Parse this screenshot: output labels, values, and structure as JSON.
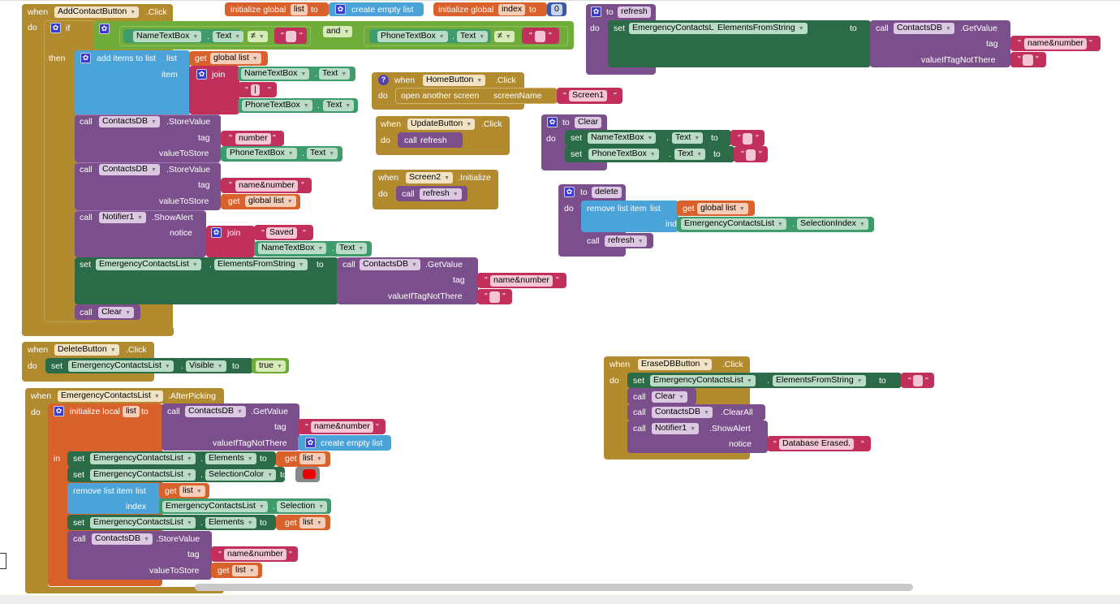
{
  "workspace": {
    "globals": {
      "list": {
        "kw": "initialize global",
        "name": "list",
        "to": "to",
        "value": "create empty list"
      },
      "index": {
        "kw": "initialize global",
        "name": "index",
        "to": "to",
        "value": "0"
      }
    },
    "add_contact": {
      "when": "when",
      "component": "AddContactButton",
      "event": ".Click",
      "do": "do",
      "if": "if",
      "then": "then",
      "cond_left": {
        "component": "NameTextBox",
        "prop": "Text",
        "op": "≠",
        "text": ""
      },
      "and": "and",
      "cond_right": {
        "component": "PhoneTextBox",
        "prop": "Text",
        "op": "≠",
        "text": ""
      },
      "add_items": {
        "label": "add items to list",
        "list_kw": "list",
        "item_kw": "item",
        "get": "get",
        "var": "global list",
        "join": "join",
        "j1_comp": "NameTextBox",
        "j1_prop": "Text",
        "j2_text": "|",
        "j3_comp": "PhoneTextBox",
        "j3_prop": "Text"
      },
      "store1": {
        "call": "call",
        "component": "ContactsDB",
        "method": ".StoreValue",
        "tag_kw": "tag",
        "tag": "number",
        "val_kw": "valueToStore",
        "val_comp": "PhoneTextBox",
        "val_prop": "Text"
      },
      "store2": {
        "call": "call",
        "component": "ContactsDB",
        "method": ".StoreValue",
        "tag_kw": "tag",
        "tag": "name&number",
        "val_kw": "valueToStore",
        "get": "get",
        "var": "global list"
      },
      "alert": {
        "call": "call",
        "component": "Notifier1",
        "method": ".ShowAlert",
        "notice_kw": "notice",
        "join": "join",
        "text": "Saved",
        "comp": "NameTextBox",
        "prop": "Text"
      },
      "set_elements": {
        "set": "set",
        "component": "EmergencyContactsList",
        "prop": "ElementsFromString",
        "to": "to",
        "call": "call",
        "db": "ContactsDB",
        "method": ".GetValue",
        "tag_kw": "tag",
        "tag": "name&number",
        "vnt_kw": "valueIfTagNotThere",
        "vnt": ""
      },
      "call_clear": {
        "call": "call",
        "proc": "Clear"
      }
    },
    "refresh_proc": {
      "to": "to",
      "name": "refresh",
      "do": "do",
      "set": "set",
      "component": "EmergencyContactsList",
      "prop": "ElementsFromString",
      "setto": "to",
      "call": "call",
      "db": "ContactsDB",
      "method": ".GetValue",
      "tag_kw": "tag",
      "tag": "name&number",
      "vnt_kw": "valueIfTagNotThere",
      "vnt": ""
    },
    "home": {
      "when": "when",
      "component": "HomeButton",
      "event": ".Click",
      "do": "do",
      "action": "open another screen",
      "param": "screenName",
      "value": "Screen1"
    },
    "update": {
      "when": "when",
      "component": "UpdateButton",
      "event": ".Click",
      "do": "do",
      "call": "call",
      "proc": "refresh"
    },
    "screen_init": {
      "when": "when",
      "component": "Screen2",
      "event": ".Initialize",
      "do": "do",
      "call": "call",
      "proc": "refresh"
    },
    "clear_proc": {
      "to": "to",
      "name": "Clear",
      "do": "do",
      "rows": [
        {
          "set": "set",
          "component": "NameTextBox",
          "prop": "Text",
          "to": "to",
          "value": ""
        },
        {
          "set": "set",
          "component": "PhoneTextBox",
          "prop": "Text",
          "to": "to",
          "value": ""
        }
      ]
    },
    "delete_proc": {
      "to": "to",
      "name": "delete",
      "do": "do",
      "remove": "remove list item",
      "list_kw": "list",
      "get": "get",
      "var": "global list",
      "index_kw": "index",
      "component": "EmergencyContactsList",
      "prop": "SelectionIndex",
      "call": "call",
      "proc": "refresh"
    },
    "delete_btn": {
      "when": "when",
      "component": "DeleteButton",
      "event": ".Click",
      "do": "do",
      "set": "set",
      "target": "EmergencyContactsList",
      "prop": "Visible",
      "to": "to",
      "value": "true"
    },
    "after_picking": {
      "when": "when",
      "component": "EmergencyContactsList",
      "event": ".AfterPicking",
      "do": "do",
      "init_local": "initialize local",
      "var": "list",
      "to": "to",
      "in": "in",
      "call": "call",
      "db": "ContactsDB",
      "method": ".GetValue",
      "tag_kw": "tag",
      "tag": "name&number",
      "vnt_kw": "valueIfTagNotThere",
      "vnt": "create empty list",
      "set1": {
        "set": "set",
        "component": "EmergencyContactsList",
        "prop": "Elements",
        "to": "to",
        "get": "get",
        "var": "list"
      },
      "set2": {
        "set": "set",
        "component": "EmergencyContactsList",
        "prop": "SelectionColor",
        "to": "to",
        "color": "#ee0000"
      },
      "remove": {
        "label": "remove list item",
        "list_kw": "list",
        "get": "get",
        "var": "list",
        "index_kw": "index",
        "component": "EmergencyContactsList",
        "prop": "Selection"
      },
      "set3": {
        "set": "set",
        "component": "EmergencyContactsList",
        "prop": "Elements",
        "to": "to",
        "get": "get",
        "var": "list"
      },
      "store": {
        "call": "call",
        "component": "ContactsDB",
        "method": ".StoreValue",
        "tag_kw": "tag",
        "tag": "name&number",
        "val_kw": "valueToStore",
        "get": "get",
        "var": "list"
      }
    },
    "erase": {
      "when": "when",
      "component": "EraseDBButton",
      "event": ".Click",
      "do": "do",
      "set": "set",
      "target": "EmergencyContactsList",
      "prop": "ElementsFromString",
      "to": "to",
      "value": "",
      "call1": {
        "call": "call",
        "proc": "Clear"
      },
      "call2": {
        "call": "call",
        "component": "ContactsDB",
        "method": ".ClearAll"
      },
      "call3": {
        "call": "call",
        "component": "Notifier1",
        "method": ".ShowAlert",
        "notice_kw": "notice",
        "text": "Database Erased."
      }
    }
  }
}
